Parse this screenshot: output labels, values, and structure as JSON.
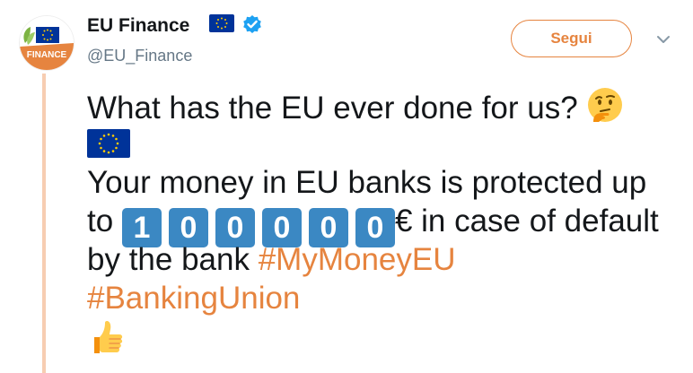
{
  "tweet": {
    "display_name": "EU Finance",
    "handle": "@EU_Finance",
    "follow_label": "Segui",
    "avatar_text": "FINANCE",
    "line1": "What has the EU ever done for us?",
    "line3": "Your money in EU banks is protected up",
    "line4_prefix": "to",
    "amount_digits": [
      "1",
      "0",
      "0",
      "0",
      "0",
      "0"
    ],
    "line4_suffix": "€ in case of default",
    "line5_prefix": "by the bank",
    "hashtag1": "#MyMoneyEU",
    "hashtag2": "#BankingUnion"
  },
  "icons": {
    "name_flag": "eu-flag-icon",
    "verified": "verified-badge-icon",
    "thinking": "thinking-face-emoji",
    "thumbs_up": "thumbs-up-emoji",
    "caret": "chevron-down-icon"
  },
  "colors": {
    "accent": "#e6843f",
    "thread_line": "#f7cdb2",
    "digit_box": "#3b88c3",
    "eu_blue": "#003399",
    "eu_star": "#ffcc00",
    "verified": "#1da1f2"
  }
}
